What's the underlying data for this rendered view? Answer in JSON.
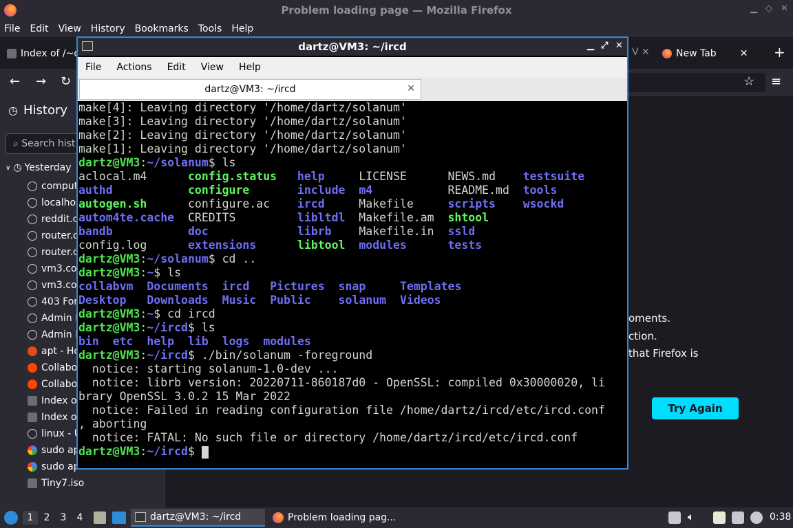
{
  "firefox": {
    "window_title": "Problem loading page — Mozilla Firefox",
    "menu": [
      "File",
      "Edit",
      "View",
      "History",
      "Bookmarks",
      "Tools",
      "Help"
    ],
    "tabs": [
      {
        "label": "Index of /~d"
      },
      {
        "label": "New Tab"
      }
    ],
    "error_lines": [
      "oments.",
      "ction.",
      "that Firefox is"
    ],
    "try_again_label": "Try Again"
  },
  "sidebar": {
    "title": "History",
    "search_placeholder": "Search hist",
    "group": "Yesterday",
    "items": [
      {
        "label": "comput",
        "icon": "globe-icon"
      },
      {
        "label": "localhos",
        "icon": "globe-icon"
      },
      {
        "label": "reddit.c",
        "icon": "globe-icon"
      },
      {
        "label": "router.c",
        "icon": "globe-icon"
      },
      {
        "label": "router.c",
        "icon": "globe-icon"
      },
      {
        "label": "vm3.co",
        "icon": "globe-icon"
      },
      {
        "label": "vm3.co",
        "icon": "globe-icon"
      },
      {
        "label": "403 For",
        "icon": "globe-icon"
      },
      {
        "label": "Admin F",
        "icon": "globe-icon"
      },
      {
        "label": "Admin F",
        "icon": "globe-icon"
      },
      {
        "label": "apt - Ho",
        "icon": "askubuntu-icon"
      },
      {
        "label": "Collabo",
        "icon": "reddit-icon"
      },
      {
        "label": "Collabo",
        "icon": "reddit-icon"
      },
      {
        "label": "Index o",
        "icon": "directory-icon"
      },
      {
        "label": "Index o",
        "icon": "directory-icon"
      },
      {
        "label": "linux - U",
        "icon": "globe-icon"
      },
      {
        "label": "sudo ap",
        "icon": "google-icon"
      },
      {
        "label": "sudo ap",
        "icon": "google-icon"
      },
      {
        "label": "Tiny7.iso",
        "icon": "directory-icon"
      }
    ]
  },
  "terminal": {
    "window_title": "dartz@VM3: ~/ircd",
    "menu": [
      "File",
      "Actions",
      "Edit",
      "View",
      "Help"
    ],
    "tab_label": "dartz@VM3: ~/ircd",
    "lines": [
      [
        {
          "t": "make[4]: Leaving directory '/home/dartz/solanum'",
          "c": ""
        }
      ],
      [
        {
          "t": "make[3]: Leaving directory '/home/dartz/solanum'",
          "c": ""
        }
      ],
      [
        {
          "t": "make[2]: Leaving directory '/home/dartz/solanum'",
          "c": ""
        }
      ],
      [
        {
          "t": "make[1]: Leaving directory '/home/dartz/solanum'",
          "c": ""
        }
      ],
      [
        {
          "t": "dartz@VM3",
          "c": "p"
        },
        {
          "t": ":",
          "c": ""
        },
        {
          "t": "~/solanum",
          "c": "d"
        },
        {
          "t": "$ ls",
          "c": ""
        }
      ],
      [
        {
          "t": "aclocal.m4      ",
          "c": ""
        },
        {
          "t": "config.status",
          "c": "x"
        },
        {
          "t": "   ",
          "c": ""
        },
        {
          "t": "help",
          "c": "d"
        },
        {
          "t": "     LICENSE      NEWS.md    ",
          "c": ""
        },
        {
          "t": "testsuite",
          "c": "d"
        }
      ],
      [
        {
          "t": "authd",
          "c": "d"
        },
        {
          "t": "           ",
          "c": ""
        },
        {
          "t": "configure",
          "c": "x"
        },
        {
          "t": "       ",
          "c": ""
        },
        {
          "t": "include",
          "c": "d"
        },
        {
          "t": "  ",
          "c": ""
        },
        {
          "t": "m4",
          "c": "d"
        },
        {
          "t": "           README.md  ",
          "c": ""
        },
        {
          "t": "tools",
          "c": "d"
        }
      ],
      [
        {
          "t": "autogen.sh",
          "c": "x"
        },
        {
          "t": "      configure.ac    ",
          "c": ""
        },
        {
          "t": "ircd",
          "c": "d"
        },
        {
          "t": "     Makefile     ",
          "c": ""
        },
        {
          "t": "scripts",
          "c": "d"
        },
        {
          "t": "    ",
          "c": ""
        },
        {
          "t": "wsockd",
          "c": "d"
        }
      ],
      [
        {
          "t": "autom4te.cache",
          "c": "d"
        },
        {
          "t": "  CREDITS         ",
          "c": ""
        },
        {
          "t": "libltdl",
          "c": "d"
        },
        {
          "t": "  Makefile.am  ",
          "c": ""
        },
        {
          "t": "shtool",
          "c": "x"
        }
      ],
      [
        {
          "t": "bandb",
          "c": "d"
        },
        {
          "t": "           ",
          "c": ""
        },
        {
          "t": "doc",
          "c": "d"
        },
        {
          "t": "             ",
          "c": ""
        },
        {
          "t": "librb",
          "c": "d"
        },
        {
          "t": "    Makefile.in  ",
          "c": ""
        },
        {
          "t": "ssld",
          "c": "d"
        }
      ],
      [
        {
          "t": "config.log      ",
          "c": ""
        },
        {
          "t": "extensions",
          "c": "d"
        },
        {
          "t": "      ",
          "c": ""
        },
        {
          "t": "libtool",
          "c": "x"
        },
        {
          "t": "  ",
          "c": ""
        },
        {
          "t": "modules",
          "c": "d"
        },
        {
          "t": "      ",
          "c": ""
        },
        {
          "t": "tests",
          "c": "d"
        }
      ],
      [
        {
          "t": "dartz@VM3",
          "c": "p"
        },
        {
          "t": ":",
          "c": ""
        },
        {
          "t": "~/solanum",
          "c": "d"
        },
        {
          "t": "$ cd ..",
          "c": ""
        }
      ],
      [
        {
          "t": "dartz@VM3",
          "c": "p"
        },
        {
          "t": ":",
          "c": ""
        },
        {
          "t": "~",
          "c": "d"
        },
        {
          "t": "$ ls",
          "c": ""
        }
      ],
      [
        {
          "t": "collabvm",
          "c": "d"
        },
        {
          "t": "  ",
          "c": ""
        },
        {
          "t": "Documents",
          "c": "d"
        },
        {
          "t": "  ",
          "c": ""
        },
        {
          "t": "ircd",
          "c": "d"
        },
        {
          "t": "   ",
          "c": ""
        },
        {
          "t": "Pictures",
          "c": "d"
        },
        {
          "t": "  ",
          "c": ""
        },
        {
          "t": "snap",
          "c": "d"
        },
        {
          "t": "     ",
          "c": ""
        },
        {
          "t": "Templates",
          "c": "d"
        }
      ],
      [
        {
          "t": "Desktop",
          "c": "d"
        },
        {
          "t": "   ",
          "c": ""
        },
        {
          "t": "Downloads",
          "c": "d"
        },
        {
          "t": "  ",
          "c": ""
        },
        {
          "t": "Music",
          "c": "d"
        },
        {
          "t": "  ",
          "c": ""
        },
        {
          "t": "Public",
          "c": "d"
        },
        {
          "t": "    ",
          "c": ""
        },
        {
          "t": "solanum",
          "c": "d"
        },
        {
          "t": "  ",
          "c": ""
        },
        {
          "t": "Videos",
          "c": "d"
        }
      ],
      [
        {
          "t": "dartz@VM3",
          "c": "p"
        },
        {
          "t": ":",
          "c": ""
        },
        {
          "t": "~",
          "c": "d"
        },
        {
          "t": "$ cd ircd",
          "c": ""
        }
      ],
      [
        {
          "t": "dartz@VM3",
          "c": "p"
        },
        {
          "t": ":",
          "c": ""
        },
        {
          "t": "~/ircd",
          "c": "d"
        },
        {
          "t": "$ ls",
          "c": ""
        }
      ],
      [
        {
          "t": "bin",
          "c": "d"
        },
        {
          "t": "  ",
          "c": ""
        },
        {
          "t": "etc",
          "c": "d"
        },
        {
          "t": "  ",
          "c": ""
        },
        {
          "t": "help",
          "c": "d"
        },
        {
          "t": "  ",
          "c": ""
        },
        {
          "t": "lib",
          "c": "d"
        },
        {
          "t": "  ",
          "c": ""
        },
        {
          "t": "logs",
          "c": "d"
        },
        {
          "t": "  ",
          "c": ""
        },
        {
          "t": "modules",
          "c": "d"
        }
      ],
      [
        {
          "t": "dartz@VM3",
          "c": "p"
        },
        {
          "t": ":",
          "c": ""
        },
        {
          "t": "~/ircd",
          "c": "d"
        },
        {
          "t": "$ ./bin/solanum -foreground",
          "c": ""
        }
      ],
      [
        {
          "t": "  notice: starting solanum-1.0-dev ...",
          "c": ""
        }
      ],
      [
        {
          "t": "  notice: librb version: 20220711-860187d0 - OpenSSL: compiled 0x30000020, li",
          "c": ""
        }
      ],
      [
        {
          "t": "brary OpenSSL 3.0.2 15 Mar 2022",
          "c": ""
        }
      ],
      [
        {
          "t": "  notice: Failed in reading configuration file /home/dartz/ircd/etc/ircd.conf",
          "c": ""
        }
      ],
      [
        {
          "t": ", aborting",
          "c": ""
        }
      ],
      [
        {
          "t": "  notice: FATAL: No such file or directory /home/dartz/ircd/etc/ircd.conf",
          "c": ""
        }
      ],
      [
        {
          "t": "dartz@VM3",
          "c": "p"
        },
        {
          "t": ":",
          "c": ""
        },
        {
          "t": "~/ircd",
          "c": "d"
        },
        {
          "t": "$ ",
          "c": ""
        }
      ]
    ]
  },
  "taskbar": {
    "workspaces": [
      "1",
      "2",
      "3",
      "4"
    ],
    "tasks": [
      "dartz@VM3: ~/ircd",
      "Problem loading pag..."
    ],
    "clock": "0:38"
  }
}
